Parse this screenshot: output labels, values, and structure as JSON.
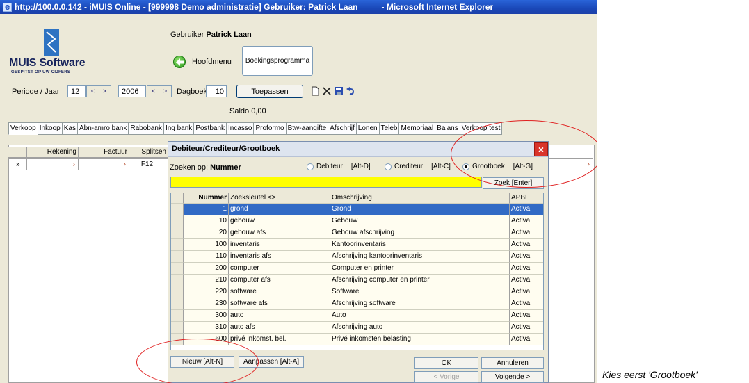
{
  "window": {
    "title": "http://100.0.0.142 - iMUIS Online - [999998 Demo administratie] Gebruiker: Patrick Laan",
    "title_suffix": "- Microsoft Internet Explorer"
  },
  "logo": {
    "title": "MUIS Software",
    "tagline": "GESPITST OP UW CIJFERS"
  },
  "header": {
    "user_prefix": "Gebruiker",
    "user_name": "Patrick Laan",
    "hoofdmenu_label": "Hoofdmenu",
    "boekingsprogramma_label": "Boekingsprogramma"
  },
  "toolbar": {
    "periode_label": "Periode / Jaar",
    "periode_value": "12",
    "jaar_value": "2006",
    "dagboek_label": "Dagboek",
    "dagboek_value": "10",
    "toepassen_label": "Toepassen",
    "saldo_text": "Saldo 0,00",
    "spin_left": "<",
    "spin_right": ">"
  },
  "tabs": [
    "Verkoop",
    "Inkoop",
    "Kas",
    "Abn-amro bank",
    "Rabobank",
    "Ing bank",
    "Postbank",
    "Incasso",
    "Proformo",
    "Btw-aangifte",
    "Afschrijf",
    "Lonen",
    "Teleb",
    "Memoriaal",
    "Balans",
    "Verkoop test"
  ],
  "grid": {
    "headers": [
      "",
      "Rekening",
      "Factuur",
      "Splitsen"
    ],
    "row_marker": "»",
    "split_value": "F12",
    "arrow": "›"
  },
  "dialog": {
    "title": "Debiteur/Crediteur/Grootboek",
    "close_label": "×",
    "zoeken_prefix": "Zoeken op:",
    "zoeken_field": "Nummer",
    "radio_debiteur": "Debiteur",
    "radio_debiteur_key": "[Alt-D]",
    "radio_crediteur": "Crediteur",
    "radio_crediteur_key": "[Alt-C]",
    "radio_grootboek": "Grootboek",
    "radio_grootboek_key": "[Alt-G]",
    "search_value": "",
    "zoek_button": "Zoek [Enter]",
    "columns": [
      "Nummer",
      "Zoeksleutel <>",
      "Omschrijving",
      "APBL"
    ],
    "rows": [
      {
        "nummer": "1",
        "zoeksleutel": "grond",
        "omschrijving": "Grond",
        "apbl": "Activa",
        "selected": true
      },
      {
        "nummer": "10",
        "zoeksleutel": "gebouw",
        "omschrijving": "Gebouw",
        "apbl": "Activa"
      },
      {
        "nummer": "20",
        "zoeksleutel": "gebouw afs",
        "omschrijving": "Gebouw afschrijving",
        "apbl": "Activa"
      },
      {
        "nummer": "100",
        "zoeksleutel": "inventaris",
        "omschrijving": "Kantoorinventaris",
        "apbl": "Activa"
      },
      {
        "nummer": "110",
        "zoeksleutel": "inventaris afs",
        "omschrijving": "Afschrijving kantoorinventaris",
        "apbl": "Activa"
      },
      {
        "nummer": "200",
        "zoeksleutel": "computer",
        "omschrijving": "Computer en printer",
        "apbl": "Activa"
      },
      {
        "nummer": "210",
        "zoeksleutel": "computer afs",
        "omschrijving": "Afschrijving computer en printer",
        "apbl": "Activa"
      },
      {
        "nummer": "220",
        "zoeksleutel": "software",
        "omschrijving": "Software",
        "apbl": "Activa"
      },
      {
        "nummer": "230",
        "zoeksleutel": "software afs",
        "omschrijving": "Afschrijving software",
        "apbl": "Activa"
      },
      {
        "nummer": "300",
        "zoeksleutel": "auto",
        "omschrijving": "Auto",
        "apbl": "Activa"
      },
      {
        "nummer": "310",
        "zoeksleutel": "auto afs",
        "omschrijving": "Afschrijving auto",
        "apbl": "Activa"
      },
      {
        "nummer": "600",
        "zoeksleutel": "privé inkomst. bel.",
        "omschrijving": "Privé inkomsten belasting",
        "apbl": "Activa"
      }
    ],
    "nieuw_button": "Nieuw [Alt-N]",
    "aanpassen_button": "Aanpassen [Alt-A]",
    "ok_button": "OK",
    "annuleren_button": "Annuleren",
    "vorige_button": "< Vorige",
    "volgende_button": "Volgende >"
  },
  "caption": "Kies eerst 'Grootboek'",
  "colors": {
    "title_bar": "#1a48b8",
    "selection": "#316ac5",
    "search_bg": "#ffff00",
    "annotation": "#e02020",
    "close": "#d9342b"
  }
}
